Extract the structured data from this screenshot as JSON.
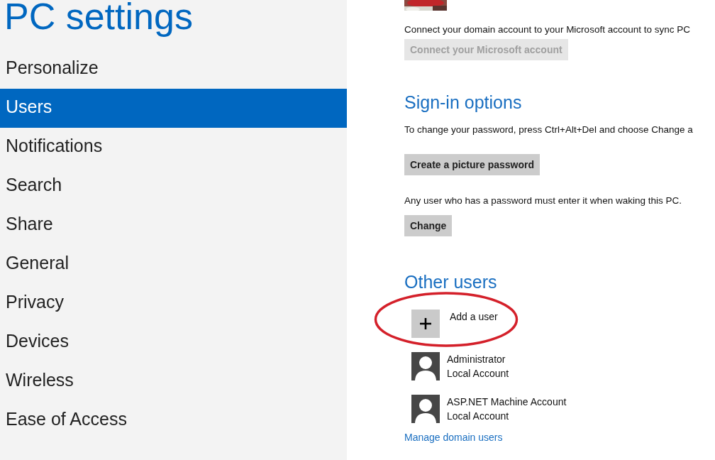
{
  "title": "PC settings",
  "sidebar": {
    "items": [
      {
        "label": "Personalize",
        "selected": false
      },
      {
        "label": "Users",
        "selected": true
      },
      {
        "label": "Notifications",
        "selected": false
      },
      {
        "label": "Search",
        "selected": false
      },
      {
        "label": "Share",
        "selected": false
      },
      {
        "label": "General",
        "selected": false
      },
      {
        "label": "Privacy",
        "selected": false
      },
      {
        "label": "Devices",
        "selected": false
      },
      {
        "label": "Wireless",
        "selected": false
      },
      {
        "label": "Ease of Access",
        "selected": false
      }
    ]
  },
  "account": {
    "text": "Connect your domain account to your Microsoft account to sync PC",
    "button": {
      "label": "Connect your Microsoft account",
      "disabled": true
    }
  },
  "sign_in": {
    "heading": "Sign-in options",
    "password_text": "To change your password, press Ctrl+Alt+Del and choose Change a",
    "picture_button": "Create a picture password",
    "wake_text": "Any user who has a password must enter it when waking this PC.",
    "change_button": "Change"
  },
  "other_users": {
    "heading": "Other users",
    "add_user": "Add a user",
    "users": [
      {
        "name": "Administrator",
        "type": "Local Account"
      },
      {
        "name": "ASP.NET Machine Account",
        "type": "Local Account"
      }
    ],
    "link": "Manage domain users"
  }
}
